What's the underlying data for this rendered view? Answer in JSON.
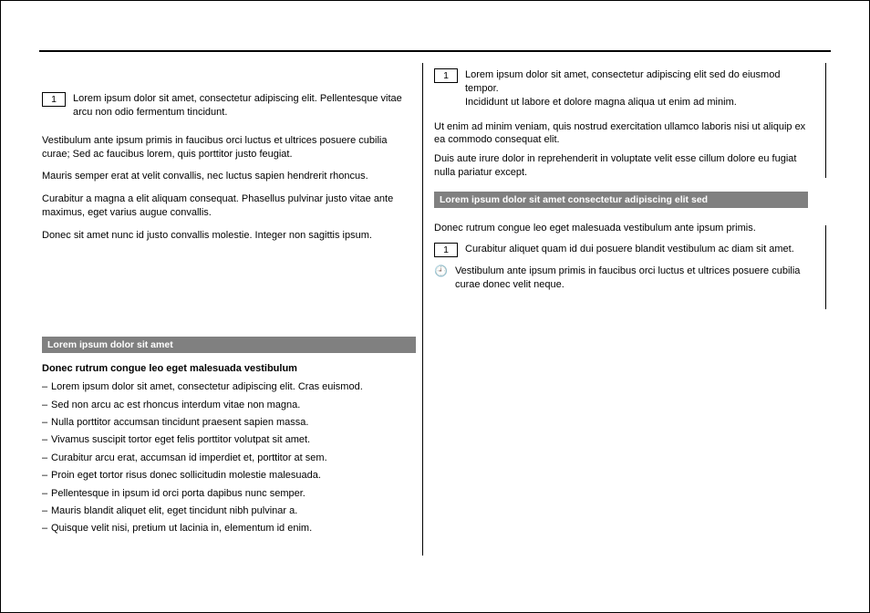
{
  "left": {
    "step1": {
      "num": "1",
      "text": "Lorem ipsum dolor sit amet, consectetur adipiscing elit. Pellentesque vitae arcu non odio fermentum tincidunt."
    },
    "note1": "Vestibulum ante ipsum primis in faucibus orci luctus et ultrices posuere cubilia curae; Sed ac faucibus lorem, quis porttitor justo feugiat.",
    "note2": "Mauris semper erat at velit convallis, nec luctus sapien hendrerit rhoncus.",
    "note3": "Curabitur a magna a elit aliquam consequat. Phasellus pulvinar justo vitae ante maximus, eget varius augue convallis.",
    "note4": "Donec sit amet nunc id justo convallis molestie. Integer non sagittis ipsum.",
    "sectionBar": "Lorem ipsum dolor sit amet",
    "heading": "Donec rutrum congue leo eget malesuada vestibulum",
    "bullets": [
      "Lorem ipsum dolor sit amet, consectetur adipiscing elit. Cras euismod.",
      "Sed non arcu ac est rhoncus interdum vitae non magna.",
      "Nulla porttitor accumsan tincidunt praesent sapien massa.",
      "Vivamus suscipit tortor eget felis porttitor volutpat sit amet.",
      "Curabitur arcu erat, accumsan id imperdiet et, porttitor at sem.",
      "Proin eget tortor risus donec sollicitudin molestie malesuada.",
      "Pellentesque in ipsum id orci porta dapibus nunc semper.",
      "Mauris blandit aliquet elit, eget tincidunt nibh pulvinar a.",
      "Quisque velit nisi, pretium ut lacinia in, elementum id enim."
    ]
  },
  "right": {
    "step1": {
      "num": "1",
      "text": "Lorem ipsum dolor sit amet, consectetur adipiscing elit sed do eiusmod tempor.",
      "text2": "Incididunt ut labore et dolore magna aliqua ut enim ad minim."
    },
    "note1": "Ut enim ad minim veniam, quis nostrud exercitation ullamco laboris nisi ut aliquip ex ea commodo consequat elit.",
    "note2": "Duis aute irure dolor in reprehenderit in voluptate velit esse cillum dolore eu fugiat nulla pariatur except.",
    "sectionBar": "Lorem ipsum dolor sit amet consectetur adipiscing elit sed",
    "sectionIntro": "Donec rutrum congue leo eget malesuada vestibulum ante ipsum primis.",
    "step2": {
      "num": "1",
      "text": "Curabitur aliquet quam id dui posuere blandit vestibulum ac diam sit amet."
    },
    "tip": "Vestibulum ante ipsum primis in faucibus orci luctus et ultrices posuere cubilia curae donec velit neque."
  }
}
